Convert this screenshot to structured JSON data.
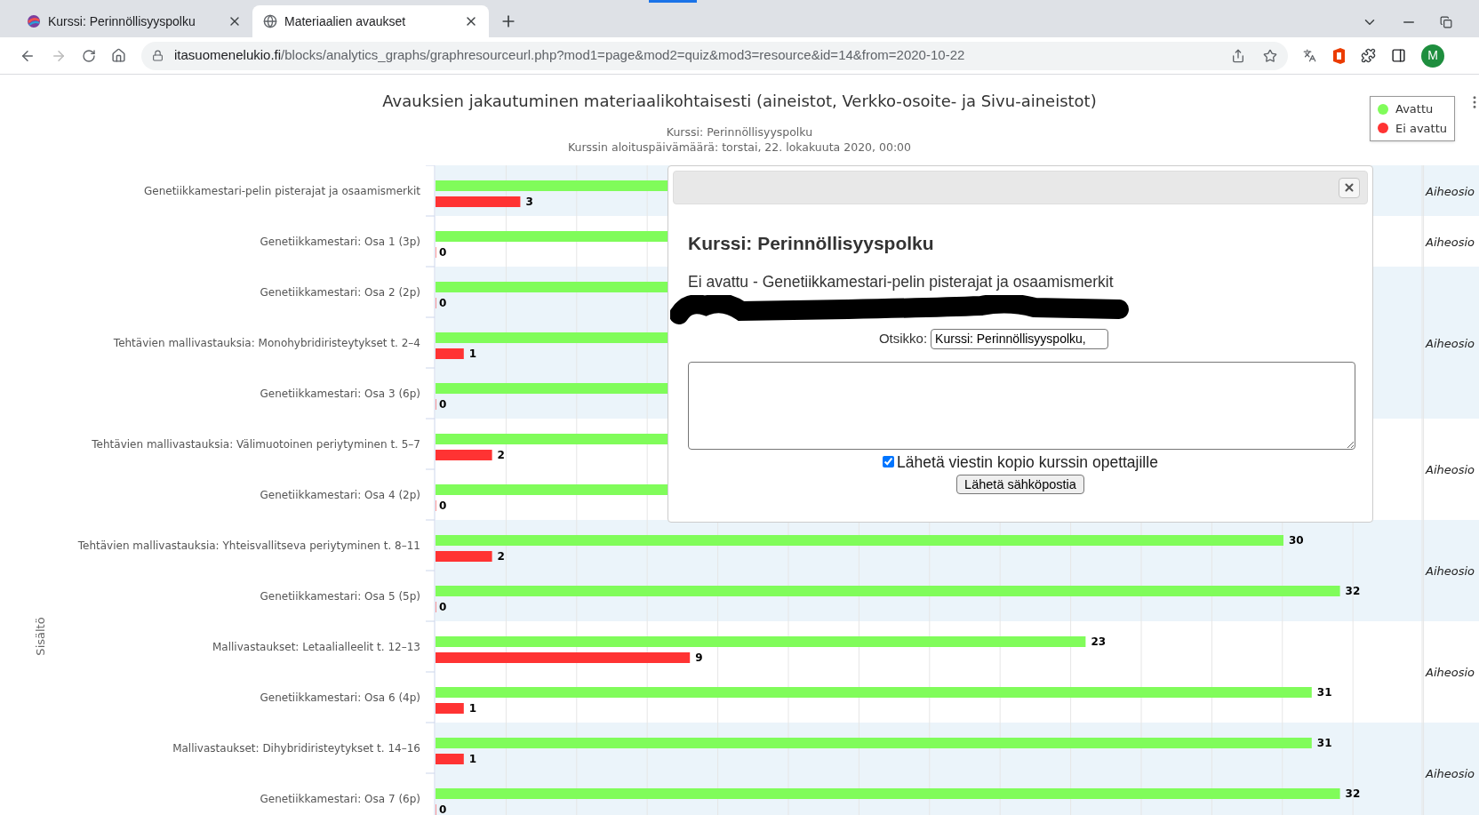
{
  "browser": {
    "tabs": [
      {
        "title": "Kurssi: Perinnöllisyyspolku",
        "selected": false
      },
      {
        "title": "Materiaalien avaukset",
        "selected": true
      }
    ],
    "url_host": "itasuomenelukio.fi",
    "url_path": "/blocks/analytics_graphs/graphresourceurl.php?mod1=page&mod2=quiz&mod3=resource&id=14&from=2020-10-22",
    "avatar": "M"
  },
  "page": {
    "title": "Avauksien jakautuminen materiaalikohtaisesti (aineistot, Verkko-osoite- ja Sivu-aineistot)",
    "subtitles": [
      "Kurssi: Perinnöllisyyspolku",
      "Kurssin aloituspäivämäärä: torstai, 22. lokakuuta 2020, 00:00"
    ],
    "group_labels": [
      "Aiheosio",
      "Aiheosio",
      "Aiheosio",
      "Aiheosio",
      "Aiheosio",
      "Aiheosio",
      "Aiheosio"
    ],
    "chart_data": {
      "type": "bar",
      "orientation": "horizontal",
      "ylabel": "Sisältö",
      "data_labels": true,
      "categories": [
        "Genetiikkamestari-pelin pisterajat ja osaamismerkit",
        "Genetiikkamestari: Osa 1 (3p)",
        "Genetiikkamestari: Osa 2 (2p)",
        "Tehtävien mallivastauksia: Monohybridiristeytykset t. 2–4",
        "Genetiikkamestari: Osa 3 (6p)",
        "Tehtävien mallivastauksia: Välimuotoinen periytyminen t. 5–7",
        "Genetiikkamestari: Osa 4 (2p)",
        "Tehtävien mallivastauksia: Yhteisvallitseva periytyminen t. 8–11",
        "Genetiikkamestari: Osa 5 (5p)",
        "Mallivastaukset: Letaalialleelit t. 12–13",
        "Genetiikkamestari: Osa 6 (4p)",
        "Mallivastaukset: Dihybridiristeytykset t. 14–16",
        "Genetiikkamestari: Osa 7 (6p)"
      ],
      "series": [
        {
          "name": "Avattu",
          "color": "#80fc5a",
          "values": [
            null,
            null,
            null,
            null,
            null,
            null,
            null,
            30,
            32,
            23,
            31,
            31,
            32
          ]
        },
        {
          "name": "Ei avattu",
          "color": "#ff3333",
          "values": [
            3,
            0,
            0,
            1,
            0,
            2,
            0,
            2,
            0,
            9,
            1,
            1,
            0
          ]
        }
      ]
    }
  },
  "dialog": {
    "heading": "Kurssi: Perinnöllisyyspolku",
    "message": "Ei avattu - Genetiikkamestari-pelin pisterajat ja osaamismerkit",
    "subject_label": "Otsikko:",
    "subject_value": "Kurssi: Perinnöllisyyspolku,",
    "copy_checkbox": {
      "label": "Lähetä viestin kopio kurssin opettajille",
      "checked": true
    },
    "send_button": "Lähetä sähköpostia"
  }
}
